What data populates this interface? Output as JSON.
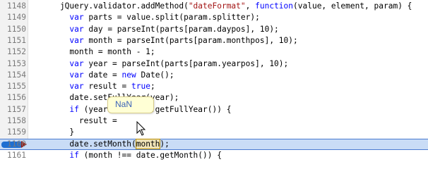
{
  "editor": {
    "lines": [
      {
        "num": "1148",
        "parts": [
          {
            "t": "    jQuery.validator.addMethod(",
            "c": ""
          },
          {
            "t": "\"dateFormat\"",
            "c": "str"
          },
          {
            "t": ", ",
            "c": ""
          },
          {
            "t": "function",
            "c": "kw"
          },
          {
            "t": "(value, element, param) {",
            "c": ""
          }
        ]
      },
      {
        "num": "1149",
        "parts": [
          {
            "t": "      ",
            "c": ""
          },
          {
            "t": "var",
            "c": "kw"
          },
          {
            "t": " parts = value.split(param.splitter);",
            "c": ""
          }
        ]
      },
      {
        "num": "1150",
        "parts": [
          {
            "t": "      ",
            "c": ""
          },
          {
            "t": "var",
            "c": "kw"
          },
          {
            "t": " day = parseInt(parts[param.daypos], 10);",
            "c": ""
          }
        ]
      },
      {
        "num": "1151",
        "parts": [
          {
            "t": "      ",
            "c": ""
          },
          {
            "t": "var",
            "c": "kw"
          },
          {
            "t": " month = parseInt(parts[param.monthpos], 10);",
            "c": ""
          }
        ]
      },
      {
        "num": "1152",
        "parts": [
          {
            "t": "      month = month - 1;",
            "c": ""
          }
        ]
      },
      {
        "num": "1153",
        "parts": [
          {
            "t": "      ",
            "c": ""
          },
          {
            "t": "var",
            "c": "kw"
          },
          {
            "t": " year = parseInt(parts[param.yearpos], 10);",
            "c": ""
          }
        ]
      },
      {
        "num": "1154",
        "parts": [
          {
            "t": "      ",
            "c": ""
          },
          {
            "t": "var",
            "c": "kw"
          },
          {
            "t": " date = ",
            "c": ""
          },
          {
            "t": "new",
            "c": "kw"
          },
          {
            "t": " Date();",
            "c": ""
          }
        ]
      },
      {
        "num": "1155",
        "parts": [
          {
            "t": "      ",
            "c": ""
          },
          {
            "t": "var",
            "c": "kw"
          },
          {
            "t": " result = ",
            "c": ""
          },
          {
            "t": "true",
            "c": "kw"
          },
          {
            "t": ";",
            "c": ""
          }
        ]
      },
      {
        "num": "1156",
        "parts": [
          {
            "t": "      date.setFullYear(year);",
            "c": ""
          }
        ]
      },
      {
        "num": "1157",
        "parts": [
          {
            "t": "      ",
            "c": ""
          },
          {
            "t": "if",
            "c": "kw"
          },
          {
            "t": " (year !== date.getFullYear()) {",
            "c": ""
          }
        ]
      },
      {
        "num": "1158",
        "parts": [
          {
            "t": "        result = ",
            "c": ""
          }
        ]
      },
      {
        "num": "1159",
        "parts": [
          {
            "t": "      }",
            "c": ""
          }
        ]
      },
      {
        "num": "1160",
        "current": true,
        "parts": [
          {
            "t": "      date.setMonth(",
            "c": ""
          },
          {
            "t": "month",
            "c": "hl"
          },
          {
            "t": ");",
            "c": ""
          }
        ]
      },
      {
        "num": "1161",
        "parts": [
          {
            "t": "      ",
            "c": ""
          },
          {
            "t": "if",
            "c": "kw"
          },
          {
            "t": " (month !== date.getMonth()) {",
            "c": ""
          }
        ]
      }
    ]
  },
  "tooltip": {
    "value": "NaN"
  },
  "colors": {
    "keyword": "#0000ff",
    "string": "#a31515",
    "current_line": "#c9dcf6",
    "breakpoint": "#1f6fd1"
  }
}
